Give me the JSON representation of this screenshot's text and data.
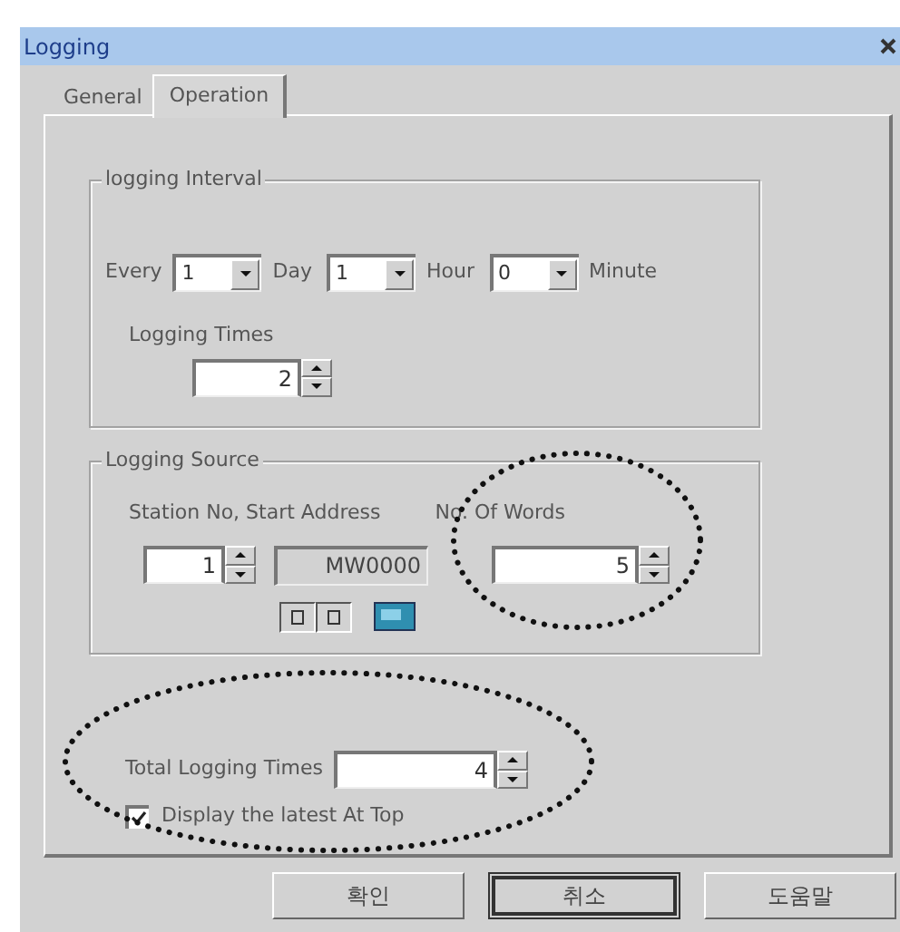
{
  "window": {
    "title": "Logging"
  },
  "tabs": [
    {
      "label": "General",
      "selected": false
    },
    {
      "label": "Operation",
      "selected": true
    }
  ],
  "interval": {
    "title": "logging Interval",
    "label": "Every",
    "fields": [
      {
        "value": "1",
        "unit": "Day"
      },
      {
        "value": "1",
        "unit": "Hour"
      },
      {
        "value": "0",
        "unit": "Minute"
      }
    ],
    "times_label": "Logging Times",
    "times_value": "2"
  },
  "source": {
    "title": "Logging Source",
    "station_label": "Station No, Start Address",
    "words_label": "No. Of Words",
    "station_value": "1",
    "address_value": "MW0000",
    "words_value": "5"
  },
  "total": {
    "label": "Total Logging Times",
    "value": "4"
  },
  "display_latest": {
    "label": "Display the latest At Top",
    "checked": true
  },
  "buttons": [
    {
      "label": "확인",
      "default": false
    },
    {
      "label": "취소",
      "default": true
    },
    {
      "label": "도움말",
      "default": false
    }
  ]
}
